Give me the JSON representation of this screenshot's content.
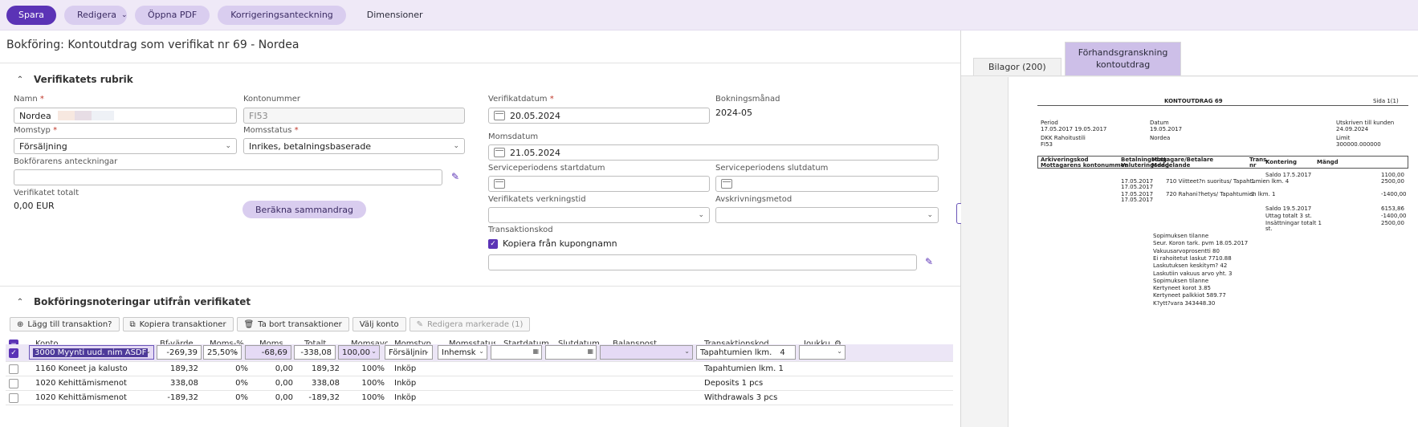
{
  "toolbar": {
    "save": "Spara",
    "edit": "Redigera",
    "open_pdf": "Öppna PDF",
    "correction": "Korrigeringsanteckning",
    "dimensions": "Dimensioner"
  },
  "page_title": "Bokföring: Kontoutdrag som verifikat nr 69 - Nordea",
  "section1": {
    "title": "Verifikatets rubrik",
    "name_label": "Namn",
    "name_value": "Nordea",
    "account_label": "Kontonummer",
    "account_value": "FI53",
    "vat_type_label": "Momstyp",
    "vat_type_value": "Försäljning",
    "vat_status_label": "Momsstatus",
    "vat_status_value": "Inrikes, betalningsbaserade",
    "notes_label": "Bokförarens anteckningar",
    "notes_value": "",
    "total_label": "Verifikatet totalt",
    "total_value": "0,00 EUR",
    "calc_button": "Beräkna sammandrag",
    "voucher_date_label": "Verifikatdatum",
    "voucher_date_value": "20.05.2024",
    "booking_month_label": "Bokningsmånad",
    "booking_month_value": "2024-05",
    "vat_date_label": "Momsdatum",
    "vat_date_value": "21.05.2024",
    "service_start_label": "Serviceperiodens startdatum",
    "service_end_label": "Serviceperiodens slutdatum",
    "validity_label": "Verifikatets verkningstid",
    "depreciation_label": "Avskrivningsmetod",
    "transaction_code_label": "Transaktionskod",
    "copy_from_coupon": "Kopiera från kupongnamn"
  },
  "section2": {
    "title": "Bokföringsnoteringar utifrån verifikatet",
    "buttons": {
      "add": "Lägg till transaktion?",
      "copy": "Kopiera transaktioner",
      "delete": "Ta bort transaktioner",
      "choose_account": "Välj konto",
      "edit_selected": "Redigera markerade (1)"
    },
    "columns": {
      "konto": "Konto",
      "bf": "Bf-värde",
      "moms_pct": "Moms-%",
      "moms": "Moms",
      "totalt": "Totalt",
      "momsavdrag": "Momsavc",
      "momstyp": "Momstyp",
      "momsstatus": "Momsstatus",
      "startdatum": "Startdatum",
      "slutdatum": "Slutdatum",
      "balanspost": "Balanspost",
      "transaktionskod": "Transaktionskod",
      "joukku": "Joukku"
    },
    "edit_row": {
      "konto": "3000 Myynti uud. nim ASDF",
      "bf": "-269,39",
      "moms_pct": "25,50%",
      "moms": "-68,69",
      "totalt": "-338,08",
      "momsavdrag": "100,00",
      "momstyp": "Försäljnin",
      "momsstatus": "Inhemsk",
      "transaktionskod": "Tapahtumien lkm.",
      "transaktionskod_num": "4"
    },
    "rows": [
      {
        "konto": "1160 Koneet ja kalusto",
        "bf": "189,32",
        "moms_pct": "0%",
        "moms": "0,00",
        "totalt": "189,32",
        "momsavdrag": "100%",
        "momstyp": "Inköp",
        "transaktionskod": "Tapahtumien lkm. 1"
      },
      {
        "konto": "1020 Kehittämismenot",
        "bf": "338,08",
        "moms_pct": "0%",
        "moms": "0,00",
        "totalt": "338,08",
        "momsavdrag": "100%",
        "momstyp": "Inköp",
        "transaktionskod": "Deposits 1 pcs"
      },
      {
        "konto": "1020 Kehittämismenot",
        "bf": "-189,32",
        "moms_pct": "0%",
        "moms": "0,00",
        "totalt": "-189,32",
        "momsavdrag": "100%",
        "momstyp": "Inköp",
        "transaktionskod": "Withdrawals 3 pcs"
      }
    ]
  },
  "right": {
    "tab_attachments": "Bilagor (200)",
    "tab_preview_line1": "Förhandsgranskning",
    "tab_preview_line2": "kontoutdrag"
  },
  "preview": {
    "heading": "KONTOUTDRAG 69",
    "page": "Sida 1(1)",
    "period_label": "Period",
    "period_value": "17.05.2017 19.05.2017",
    "bank_name": "DKK Rahoitustili",
    "bank_account": "FI53",
    "date_label": "Datum",
    "date_value": "19.05.2017",
    "bank": "Nordea",
    "printed_label": "Utskriven till kunden",
    "printed_value": "24.09.2024",
    "limit_label": "Limit",
    "limit_value": "300000.000000",
    "col_archive": "Arkiveringskod",
    "col_archive2": "Mottagarens kontonummer",
    "col_paydate": "Betalningsdag",
    "col_paydate2": "Valuteringsdag",
    "col_receiver": "Mottagare/Betalare",
    "col_receiver2": "Meddelande",
    "col_trans": "Trans.",
    "col_trans2": "nr",
    "col_kontering": "Kontering",
    "col_amount": "Mängd",
    "saldo_start": "Saldo 17.5.2017",
    "saldo_start_val": "1100,00",
    "tx1_date": "17.05.2017",
    "tx1_date2": "17.05.2017",
    "tx1_text": "710 Viitteet?n suoritus/ Tapahtumien lkm. 4",
    "tx1_nr": "1",
    "tx1_amt": "2500,00",
    "tx2_date": "17.05.2017",
    "tx2_date2": "17.05.2017",
    "tx2_text": "720 Rahani?hetys/ Tapahtumien lkm. 1",
    "tx2_nr": "2",
    "tx2_amt": "-1400,00",
    "saldo_end": "Saldo 19.5.2017",
    "saldo_end_val": "6153,86",
    "withdraw": "Uttag totalt 3 st.",
    "withdraw_val": "-1400,00",
    "deposit": "Insättningar totalt 1",
    "deposit2": "st.",
    "deposit_val": "2500,00",
    "notes": [
      "Sopimuksen tilanne",
      "Seur. Koron tark. pvm 18.05.2017",
      "Vakuusarvoprosentti 80",
      "Ei rahoitetut laskut 7710.88",
      "Laskutuksen keskitym? 42",
      "Laskutiin vakuus arvo yht. 3",
      "Sopimuksen tilanne",
      "Kertyneet korot 3.85",
      "Kertyneet palkkiot 589.77",
      "K?ytt?vara 343448.30"
    ]
  }
}
